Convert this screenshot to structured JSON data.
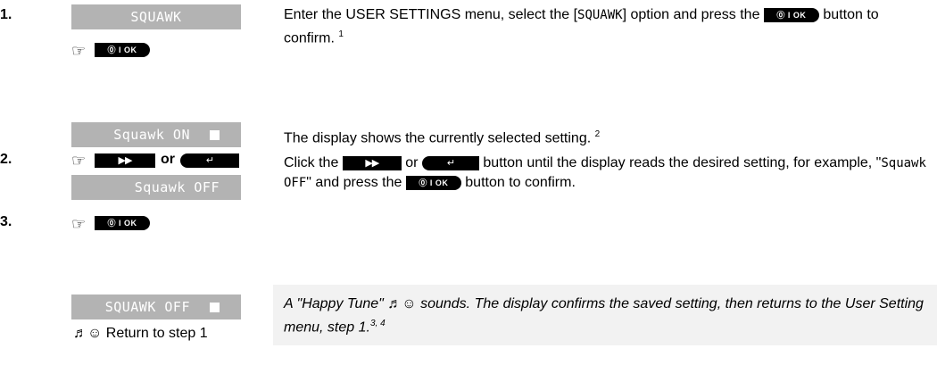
{
  "steps": {
    "s1": "1.",
    "s2": "2.",
    "s3": "3."
  },
  "displays": {
    "squawk": "SQUAWK",
    "squawk_on": "Squawk ON",
    "squawk_off": "Squawk OFF",
    "squawk_off_saved": "SQUAWK OFF"
  },
  "buttons": {
    "ok_label": "⓪ I OK",
    "fwd_label": "▶▶",
    "back_label": "↵"
  },
  "icons": {
    "hand": "pointing-hand-icon",
    "square": "lcd-block-icon",
    "melody": "music-note-icon",
    "smile": "smiley-icon"
  },
  "or_word": "or",
  "desc1": {
    "a": "Enter the USER SETTINGS menu, select the [",
    "code": "SQUAWK",
    "b": "] option and press the",
    "c": "button to confirm.",
    "sup": "1"
  },
  "desc2": {
    "text": "The display shows the currently selected setting.",
    "sup": "2"
  },
  "desc3": {
    "a": "Click the",
    "or": "or",
    "b": "button until the display reads the desired setting, for example, \"",
    "code": "Squawk OFF",
    "c": "\" and press the",
    "d": "button to confirm."
  },
  "note": {
    "text": "A \"Happy Tune\" ♬☺ sounds. The display confirms the saved setting, then returns to the User Setting menu, step 1.",
    "sup": "3, 4"
  },
  "return_line": "♬☺ Return to step 1"
}
